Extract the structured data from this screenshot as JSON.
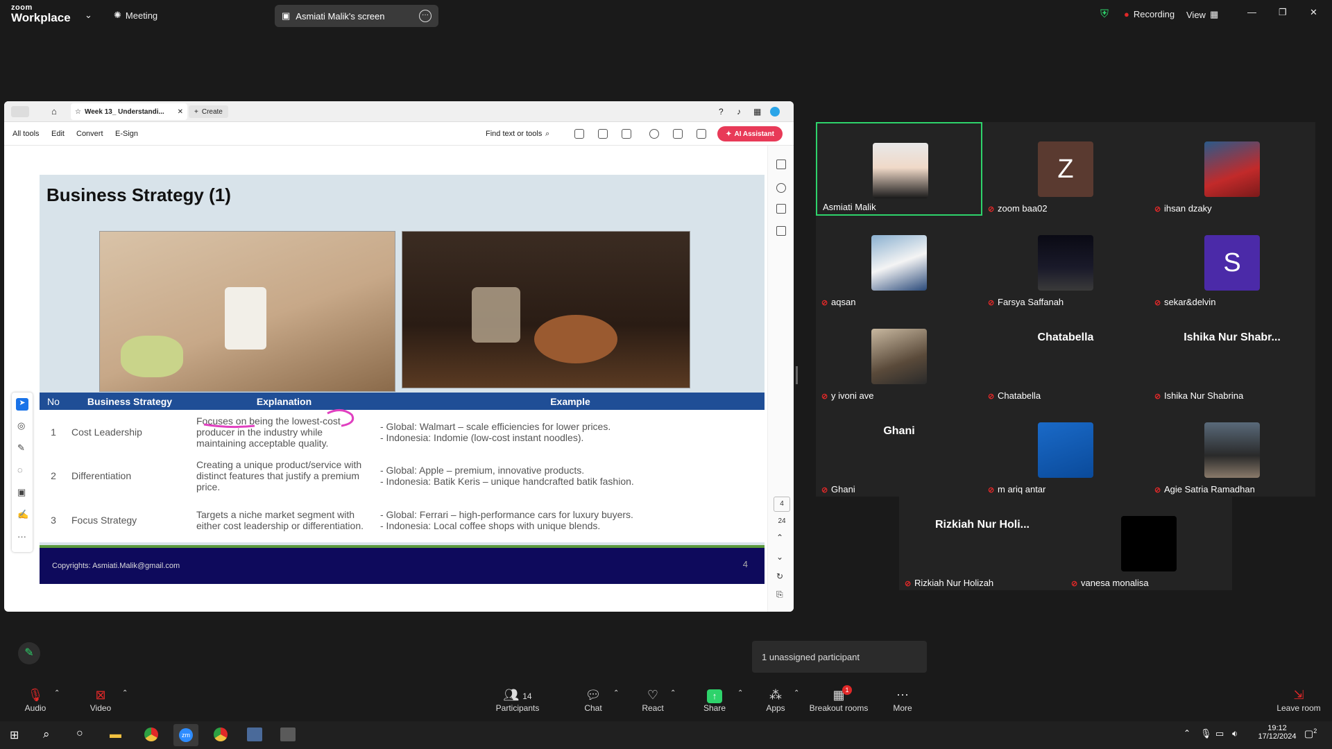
{
  "topbar": {
    "brand_zoom": "zoom",
    "brand_workplace": "Workplace",
    "meeting_label": "Meeting",
    "screen_label": "Asmiati Malik's screen",
    "recording_label": "Recording",
    "view_label": "View"
  },
  "acrobat": {
    "tab_title": "Week 13_ Understandi...",
    "create_label": "Create",
    "menu": [
      "All tools",
      "Edit",
      "Convert",
      "E-Sign"
    ],
    "find_label": "Find text or tools",
    "ai_label": "AI Assistant",
    "page_current": "4",
    "page_total": "24"
  },
  "slide": {
    "title": "Business Strategy (1)",
    "headers": [
      "No",
      "Business Strategy",
      "Explanation",
      "Example"
    ],
    "rows": [
      {
        "no": "1",
        "strategy": "Cost Leadership",
        "explanation": "Focuses on being the lowest-cost producer in the industry while maintaining acceptable quality.",
        "ex1": "- Global: Walmart – scale efficiencies for lower prices.",
        "ex2": "- Indonesia: Indomie (low-cost instant noodles)."
      },
      {
        "no": "2",
        "strategy": "Differentiation",
        "explanation": "Creating a unique product/service with distinct features that justify a premium price.",
        "ex1": "- Global: Apple – premium, innovative products.",
        "ex2": "- Indonesia: Batik Keris – unique handcrafted batik fashion."
      },
      {
        "no": "3",
        "strategy": "Focus Strategy",
        "explanation": "Targets a niche market segment with either cost leadership or differentiation.",
        "ex1": "- Global: Ferrari – high-performance cars for luxury buyers.",
        "ex2": "- Indonesia: Local coffee shops with unique blends."
      }
    ],
    "footer_copy": "Copyrights: Asmiati.Malik@gmail.com",
    "footer_page": "4"
  },
  "participants": [
    {
      "name": "Asmiati Malik",
      "avatar": "photo",
      "muted": false,
      "active": true
    },
    {
      "name": "zoom baa02",
      "avatar": "initial",
      "initial": "Z",
      "color": "#5a3a30",
      "muted": true
    },
    {
      "name": "ihsan dzaky",
      "avatar": "photo",
      "muted": true
    },
    {
      "name": "aqsan",
      "avatar": "photo",
      "muted": true
    },
    {
      "name": "Farsya Saffanah",
      "avatar": "photo",
      "muted": true
    },
    {
      "name": "sekar&delvin",
      "avatar": "initial",
      "initial": "S",
      "color": "#4b2aa8",
      "muted": true
    },
    {
      "name": "y ivoni ave",
      "avatar": "photo",
      "muted": true
    },
    {
      "name": "Chatabella",
      "avatar": "text",
      "bigtext": "Chatabella",
      "muted": true
    },
    {
      "name": "Ishika Nur Shabrina",
      "avatar": "text",
      "bigtext": "Ishika Nur Shabr...",
      "muted": true
    },
    {
      "name": "Ghani",
      "avatar": "text",
      "bigtext": "Ghani",
      "muted": true
    },
    {
      "name": "m ariq antar",
      "avatar": "photo",
      "muted": true
    },
    {
      "name": "Agie Satria Ramadhan",
      "avatar": "photo",
      "muted": true
    },
    {
      "name": "Rizkiah Nur Holizah",
      "avatar": "text",
      "bigtext": "Rizkiah Nur Holi...",
      "muted": true
    },
    {
      "name": "vanesa monalisa",
      "avatar": "photo",
      "muted": true
    }
  ],
  "unassigned": "1 unassigned participant",
  "toolbar": {
    "audio": "Audio",
    "video": "Video",
    "participants": "Participants",
    "participants_count": "14",
    "chat": "Chat",
    "react": "React",
    "share": "Share",
    "apps": "Apps",
    "breakout": "Breakout rooms",
    "breakout_badge": "1",
    "more": "More",
    "leave": "Leave room"
  },
  "taskbar": {
    "time": "19:12",
    "date": "17/12/2024",
    "notif": "2"
  }
}
